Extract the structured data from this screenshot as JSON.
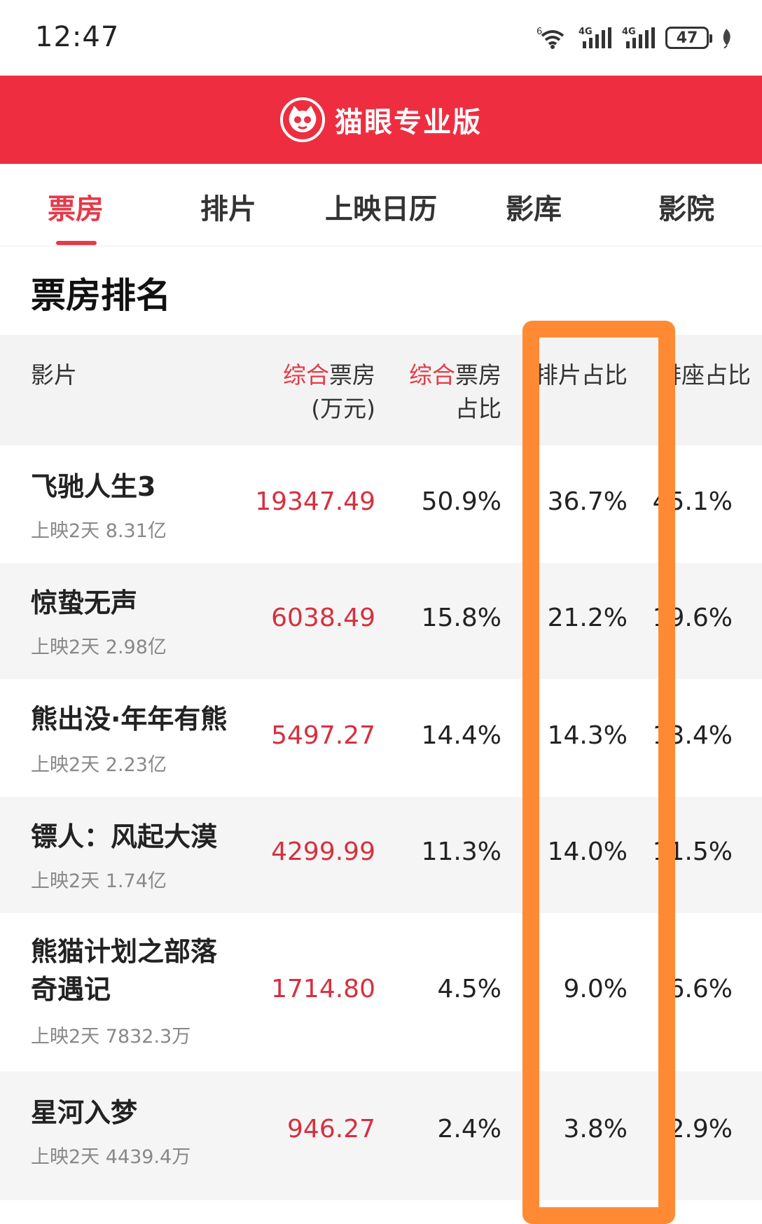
{
  "status_bar": {
    "time": "12:47",
    "battery": "47",
    "network_label_1": "4G",
    "network_label_2": "4G",
    "wifi_badge": "6"
  },
  "app": {
    "title": "猫眼专业版"
  },
  "tabs": [
    {
      "label": "票房",
      "active": true
    },
    {
      "label": "排片",
      "active": false
    },
    {
      "label": "上映日历",
      "active": false
    },
    {
      "label": "影库",
      "active": false
    },
    {
      "label": "影院",
      "active": false
    }
  ],
  "section": {
    "title": "票房排名"
  },
  "table": {
    "headers": {
      "movie": "影片",
      "boxoffice_prefix": "综合",
      "boxoffice_suffix": "票房",
      "boxoffice_unit": "(万元)",
      "share_prefix": "综合",
      "share_suffix": "票房",
      "share_line2": "占比",
      "screening_share": "排片占比",
      "seat_share": "排座占比"
    },
    "rows": [
      {
        "title": "飞驰人生3",
        "sub": "上映2天 8.31亿",
        "boxoffice": "19347.49",
        "share": "50.9%",
        "screening": "36.7%",
        "seat": "45.1%"
      },
      {
        "title": "惊蛰无声",
        "sub": "上映2天 2.98亿",
        "boxoffice": "6038.49",
        "share": "15.8%",
        "screening": "21.2%",
        "seat": "19.6%"
      },
      {
        "title": "熊出没·年年有熊",
        "sub": "上映2天 2.23亿",
        "boxoffice": "5497.27",
        "share": "14.4%",
        "screening": "14.3%",
        "seat": "13.4%"
      },
      {
        "title": "镖人：风起大漠",
        "sub": "上映2天 1.74亿",
        "boxoffice": "4299.99",
        "share": "11.3%",
        "screening": "14.0%",
        "seat": "11.5%"
      },
      {
        "title": "熊猫计划之部落奇遇记",
        "sub": "上映2天 7832.3万",
        "boxoffice": "1714.80",
        "share": "4.5%",
        "screening": "9.0%",
        "seat": "6.6%"
      },
      {
        "title": "星河入梦",
        "sub": "上映2天 4439.4万",
        "boxoffice": "946.27",
        "share": "2.4%",
        "screening": "3.8%",
        "seat": "2.9%"
      }
    ]
  },
  "colors": {
    "brand_red": "#ee2e40",
    "accent_red": "#e53a48",
    "highlight_orange": "#ff8a33"
  }
}
